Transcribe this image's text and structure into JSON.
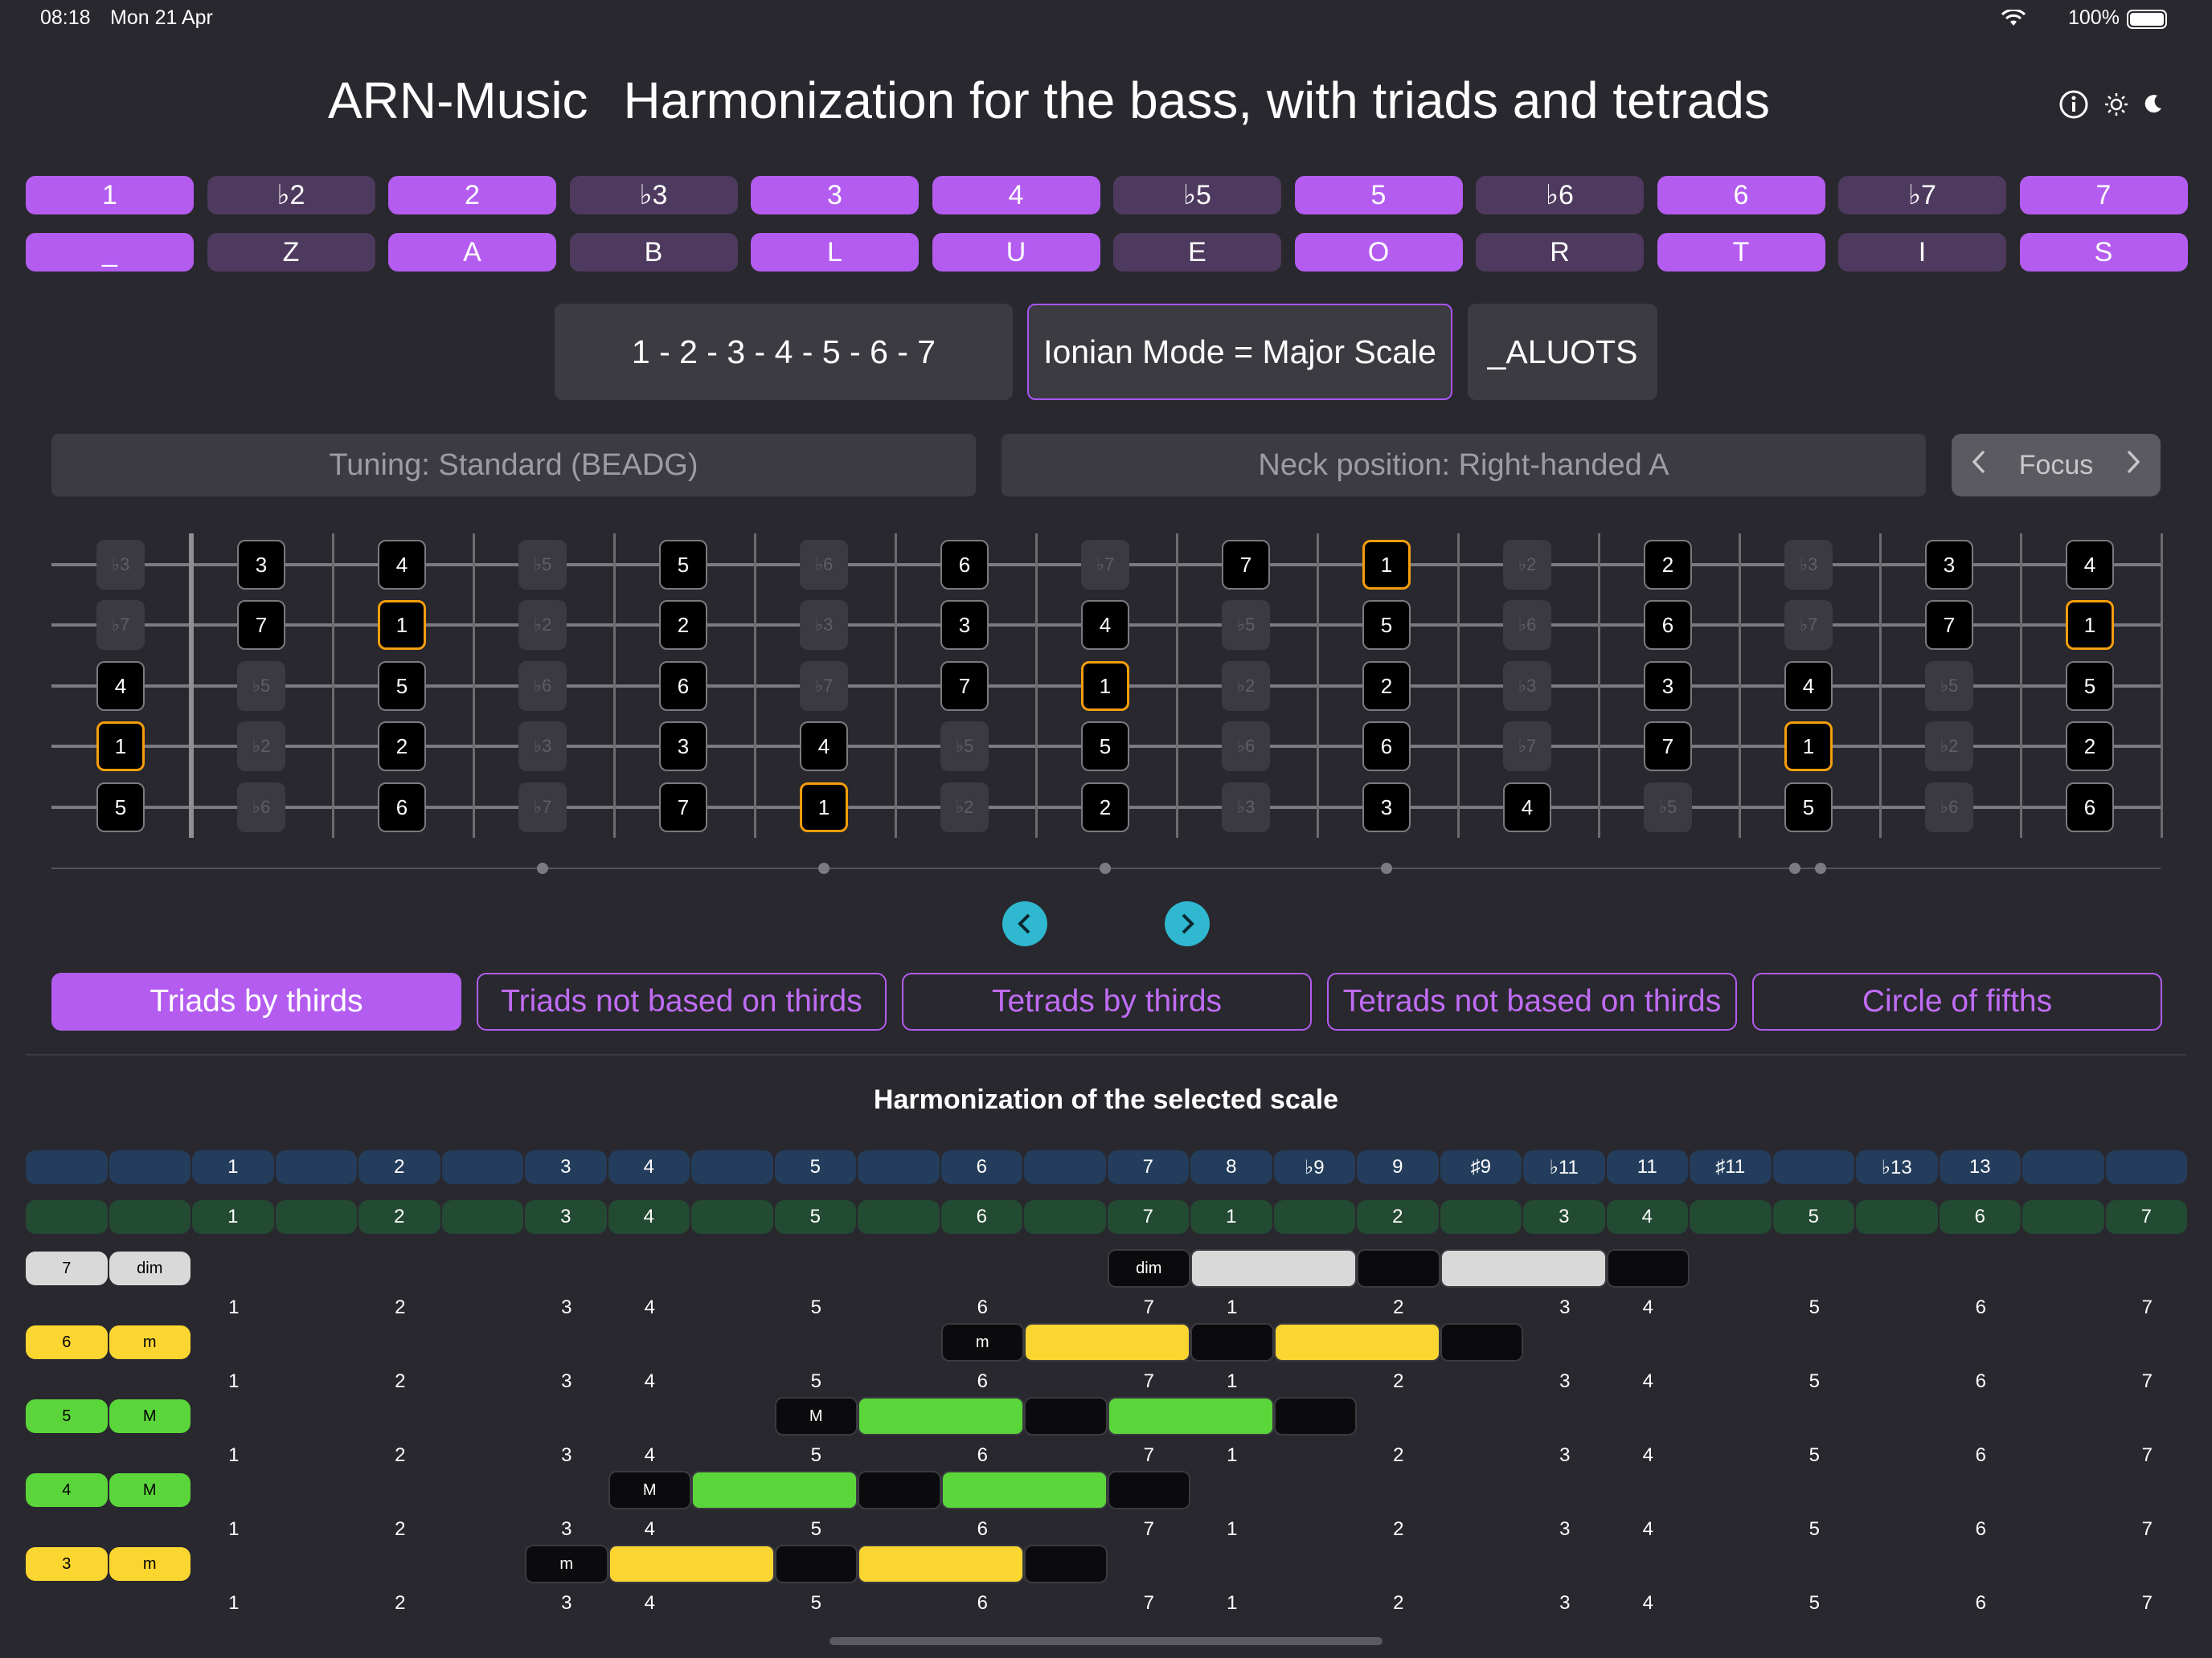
{
  "status": {
    "time": "08:18",
    "date": "Mon 21 Apr",
    "battery": "100%"
  },
  "header": {
    "app": "ARN-Music",
    "title": "Harmonization for the bass, with triads and tetrads"
  },
  "header_icons": [
    "info-icon",
    "sun-icon",
    "moon-icon"
  ],
  "degrees": [
    {
      "label": "1",
      "on": true
    },
    {
      "label": "♭2",
      "on": false
    },
    {
      "label": "2",
      "on": true
    },
    {
      "label": "♭3",
      "on": false
    },
    {
      "label": "3",
      "on": true
    },
    {
      "label": "4",
      "on": true
    },
    {
      "label": "♭5",
      "on": false
    },
    {
      "label": "5",
      "on": true
    },
    {
      "label": "♭6",
      "on": false
    },
    {
      "label": "6",
      "on": true
    },
    {
      "label": "♭7",
      "on": false
    },
    {
      "label": "7",
      "on": true
    }
  ],
  "letters": [
    "_",
    "Z",
    "A",
    "B",
    "L",
    "U",
    "E",
    "O",
    "R",
    "T",
    "I",
    "S"
  ],
  "scale": {
    "formula": "1 - 2 - 3 - 4 - 5 - 6 - 7",
    "mode": "Ionian Mode = Major Scale",
    "code": "_ALUOTS"
  },
  "tuning": {
    "label": "Tuning: Standard (BEADG)",
    "neck": "Neck position: Right-handed A",
    "focus": "Focus"
  },
  "fretboard": {
    "strings": [
      [
        "♭3",
        "3",
        "4",
        "♭5",
        "5",
        "♭6",
        "6",
        "♭7",
        "7",
        "1",
        "♭2",
        "2",
        "♭3",
        "3",
        "4"
      ],
      [
        "♭7",
        "7",
        "1",
        "♭2",
        "2",
        "♭3",
        "3",
        "4",
        "♭5",
        "5",
        "♭6",
        "6",
        "♭7",
        "7",
        "1"
      ],
      [
        "4",
        "♭5",
        "5",
        "♭6",
        "6",
        "♭7",
        "7",
        "1",
        "♭2",
        "2",
        "♭3",
        "3",
        "4",
        "♭5",
        "5"
      ],
      [
        "1",
        "♭2",
        "2",
        "♭3",
        "3",
        "4",
        "♭5",
        "5",
        "♭6",
        "6",
        "♭7",
        "7",
        "1",
        "♭2",
        "2"
      ],
      [
        "5",
        "♭6",
        "6",
        "♭7",
        "7",
        "1",
        "♭2",
        "2",
        "♭3",
        "3",
        "4",
        "♭5",
        "5",
        "♭6",
        "6"
      ]
    ],
    "in_scale": [
      "1",
      "2",
      "3",
      "4",
      "5",
      "6",
      "7"
    ],
    "root": "1"
  },
  "tabs": [
    {
      "label": "Triads by thirds",
      "active": true
    },
    {
      "label": "Triads not based on thirds",
      "active": false
    },
    {
      "label": "Tetrads by thirds",
      "active": false
    },
    {
      "label": "Tetrads not based on thirds",
      "active": false
    },
    {
      "label": "Circle of fifths",
      "active": false
    }
  ],
  "harmonization": {
    "title": "Harmonization of the selected scale",
    "interval_row": [
      "",
      "",
      "1",
      "",
      "2",
      "",
      "3",
      "4",
      "",
      "5",
      "",
      "6",
      "",
      "7",
      "8",
      "♭9",
      "9",
      "♯9",
      "♭11",
      "11",
      "♯11",
      "",
      "♭13",
      "13",
      "",
      ""
    ],
    "degree_row": [
      "",
      "",
      "1",
      "",
      "2",
      "",
      "3",
      "4",
      "",
      "5",
      "",
      "6",
      "",
      "7",
      "1",
      "",
      "2",
      "",
      "3",
      "4",
      "",
      "5",
      "",
      "6",
      "",
      "7"
    ],
    "number_row": [
      "",
      "",
      "1",
      "",
      "2",
      "",
      "3",
      "4",
      "",
      "5",
      "",
      "6",
      "",
      "7",
      "1",
      "",
      "2",
      "",
      "3",
      "4",
      "",
      "5",
      "",
      "6",
      "",
      "7"
    ],
    "chords": [
      {
        "degree": "7",
        "quality": "dim",
        "color": "#d9d9d9",
        "start": 13
      },
      {
        "degree": "6",
        "quality": "m",
        "color": "#fcd630",
        "start": 11
      },
      {
        "degree": "5",
        "quality": "M",
        "color": "#5ad63a",
        "start": 9
      },
      {
        "degree": "4",
        "quality": "M",
        "color": "#5ad63a",
        "start": 7
      },
      {
        "degree": "3",
        "quality": "m",
        "color": "#fcd630",
        "start": 6
      }
    ]
  },
  "colors": {
    "accent": "#b45cf0",
    "root": "#f59e0b",
    "nav": "#2fb8cf"
  }
}
